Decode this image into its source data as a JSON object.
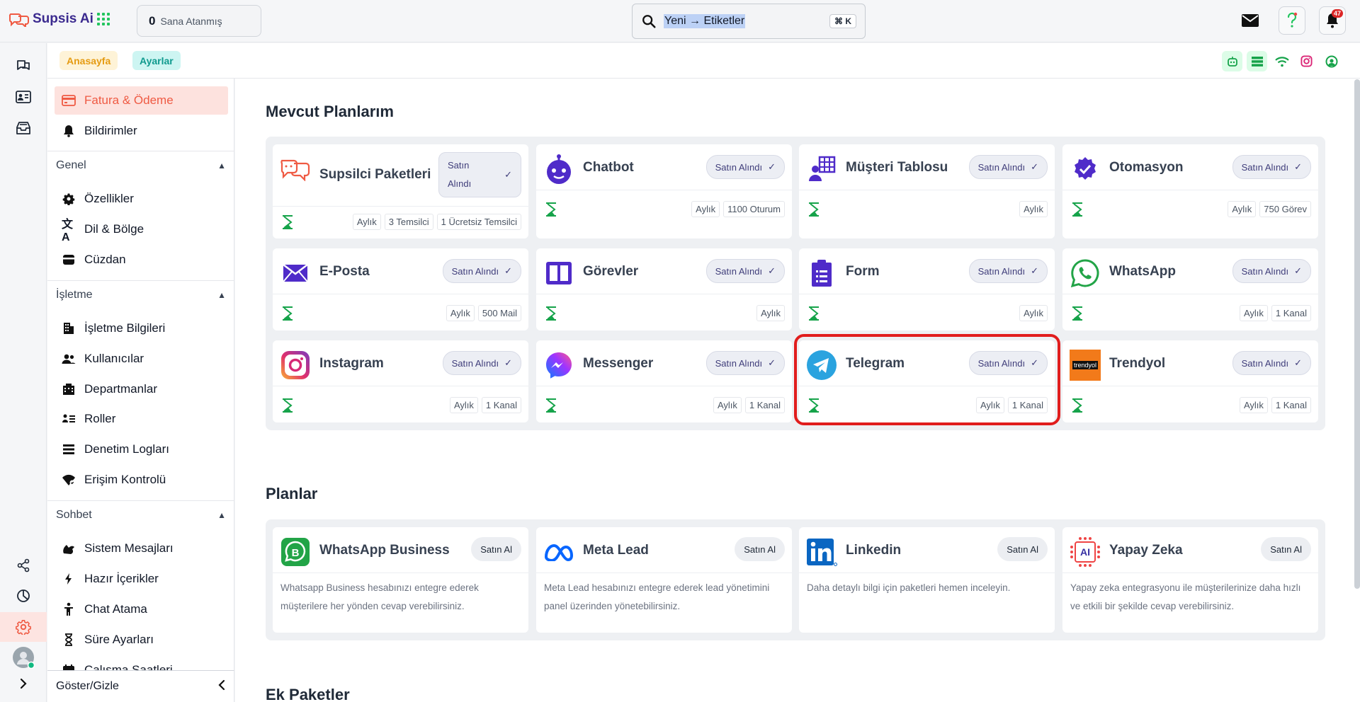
{
  "app": {
    "name": "Supsis Ai"
  },
  "header": {
    "assigned_count": "0",
    "assigned_label": "Sana Atanmış",
    "search_text": "Yeni → Etiketler",
    "search_shortcut": "⌘ K",
    "notification_count": "47"
  },
  "breadcrumb": {
    "home": "Anasayfa",
    "current": "Ayarlar"
  },
  "sidebar": {
    "top_items": [
      {
        "label": "Fatura & Ödeme",
        "icon": "billing-icon",
        "active": true
      },
      {
        "label": "Bildirimler",
        "icon": "bell-icon"
      }
    ],
    "groups": [
      {
        "title": "Genel",
        "items": [
          {
            "label": "Özellikler",
            "icon": "gear-icon"
          },
          {
            "label": "Dil & Bölge",
            "icon": "translate-icon"
          },
          {
            "label": "Cüzdan",
            "icon": "wallet-icon"
          }
        ]
      },
      {
        "title": "İşletme",
        "items": [
          {
            "label": "İşletme Bilgileri",
            "icon": "building-icon"
          },
          {
            "label": "Kullanıcılar",
            "icon": "users-icon"
          },
          {
            "label": "Departmanlar",
            "icon": "departments-icon"
          },
          {
            "label": "Roller",
            "icon": "roles-icon"
          },
          {
            "label": "Denetim Logları",
            "icon": "list-icon"
          },
          {
            "label": "Erişim Kontrolü",
            "icon": "access-icon"
          }
        ]
      },
      {
        "title": "Sohbet",
        "items": [
          {
            "label": "Sistem Mesajları",
            "icon": "system-messages-icon"
          },
          {
            "label": "Hazır İçerikler",
            "icon": "bolt-icon"
          },
          {
            "label": "Chat Atama",
            "icon": "person-icon"
          },
          {
            "label": "Süre Ayarları",
            "icon": "hourglass-icon"
          },
          {
            "label": "Çalışma Saatleri",
            "icon": "calendar-icon"
          }
        ]
      }
    ],
    "toggle_label": "Göster/Gizle"
  },
  "sections": {
    "my_plans_title": "Mevcut Planlarım",
    "plans_title": "Planlar",
    "extra_title": "Ek Paketler"
  },
  "purchased_label": "Satın Alındı",
  "purchased_label_lines": [
    "Satın",
    "Alındı"
  ],
  "buy_label": "Satın Al",
  "my_plans": [
    {
      "name": "Supsilci Paketleri",
      "icon": "supsis-icon",
      "tags": [
        "Aylık",
        "3 Temsilci",
        "1 Ücretsiz Temsilci"
      ]
    },
    {
      "name": "Chatbot",
      "icon": "chatbot-icon",
      "tags": [
        "Aylık",
        "1100 Oturum"
      ]
    },
    {
      "name": "Müşteri Tablosu",
      "icon": "customer-table-icon",
      "tags": [
        "Aylık"
      ]
    },
    {
      "name": "Otomasyon",
      "icon": "automation-icon",
      "tags": [
        "Aylık",
        "750 Görev"
      ]
    },
    {
      "name": "E-Posta",
      "icon": "email-icon",
      "tags": [
        "Aylık",
        "500 Mail"
      ]
    },
    {
      "name": "Görevler",
      "icon": "tasks-icon",
      "tags": [
        "Aylık"
      ]
    },
    {
      "name": "Form",
      "icon": "form-icon",
      "tags": [
        "Aylık"
      ]
    },
    {
      "name": "WhatsApp",
      "icon": "whatsapp-icon",
      "tags": [
        "Aylık",
        "1 Kanal"
      ]
    },
    {
      "name": "Instagram",
      "icon": "instagram-icon",
      "tags": [
        "Aylık",
        "1 Kanal"
      ]
    },
    {
      "name": "Messenger",
      "icon": "messenger-icon",
      "tags": [
        "Aylık",
        "1 Kanal"
      ]
    },
    {
      "name": "Telegram",
      "icon": "telegram-icon",
      "tags": [
        "Aylık",
        "1 Kanal"
      ]
    },
    {
      "name": "Trendyol",
      "icon": "trendyol-icon",
      "tags": [
        "Aylık",
        "1 Kanal"
      ]
    }
  ],
  "plans": [
    {
      "name": "WhatsApp Business",
      "icon": "whatsapp-business-icon",
      "description": "Whatsapp Business hesabınızı entegre ederek müşterilere her yönden cevap verebilirsiniz."
    },
    {
      "name": "Meta Lead",
      "icon": "meta-icon",
      "description": "Meta Lead hesabınızı entegre ederek lead yönetimini panel üzerinden yönetebilirsiniz."
    },
    {
      "name": "Linkedin",
      "icon": "linkedin-icon",
      "description": "Daha detaylı bilgi için paketleri hemen inceleyin."
    },
    {
      "name": "Yapay Zeka",
      "icon": "ai-icon",
      "description": "Yapay zeka entegrasyonu ile müşterilerinize daha hızlı ve etkili bir şekilde cevap verebilirsiniz."
    }
  ],
  "trendyol_logo_text": "trendyol",
  "ai_logo_text": "AI",
  "colors": {
    "accent": "#ef5a43",
    "purple": "#4f2bc9",
    "green": "#22c55e",
    "highlight": "#e11d1d"
  }
}
